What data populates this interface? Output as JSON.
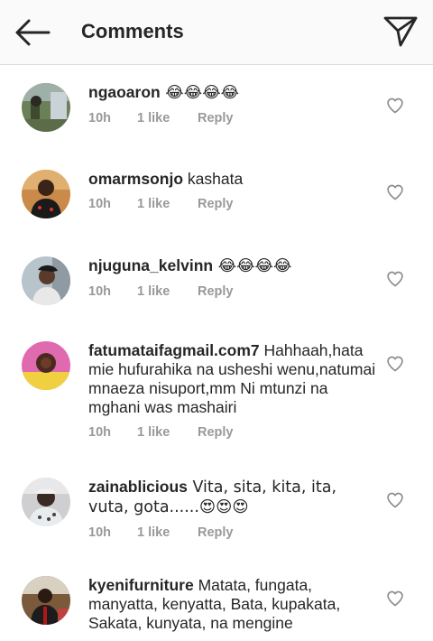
{
  "header": {
    "title": "Comments",
    "back_icon": "arrow-left-icon",
    "send_icon": "paper-plane-icon"
  },
  "comments": [
    {
      "username": "ngaoaron",
      "text": " 😂😂😂😂",
      "time": "10h",
      "likes": "1 like",
      "reply": "Reply"
    },
    {
      "username": "omarmsonjo",
      "text": " kashata",
      "time": "10h",
      "likes": "1 like",
      "reply": "Reply"
    },
    {
      "username": "njuguna_kelvinn",
      "text": " 😂😂😂😂",
      "time": "10h",
      "likes": "1 like",
      "reply": "Reply"
    },
    {
      "username": "fatumataifagmail.com7",
      "text": " Hahhaah,hata mie hufurahika na usheshi wenu,natumai mnaeza nisuport,mm Ni mtunzi na mghani was mashairi",
      "time": "10h",
      "likes": "1 like",
      "reply": "Reply"
    },
    {
      "username": "zainablicious",
      "text": " Vita, sita, kita, ita, vuta, gota......😍😍😍",
      "time": "10h",
      "likes": "1 like",
      "reply": "Reply"
    },
    {
      "username": "kyenifurniture",
      "text": " Matata, fungata, manyatta, kenyatta, Bata, kupakata, Sakata, kunyata, na mengine",
      "time": "",
      "likes": "",
      "reply": ""
    }
  ],
  "icons": {
    "like": "heart-outline-icon"
  },
  "colors": {
    "text": "#262626",
    "meta": "#999999",
    "header_bg": "#fafafa",
    "divider": "#dbdbdb"
  }
}
